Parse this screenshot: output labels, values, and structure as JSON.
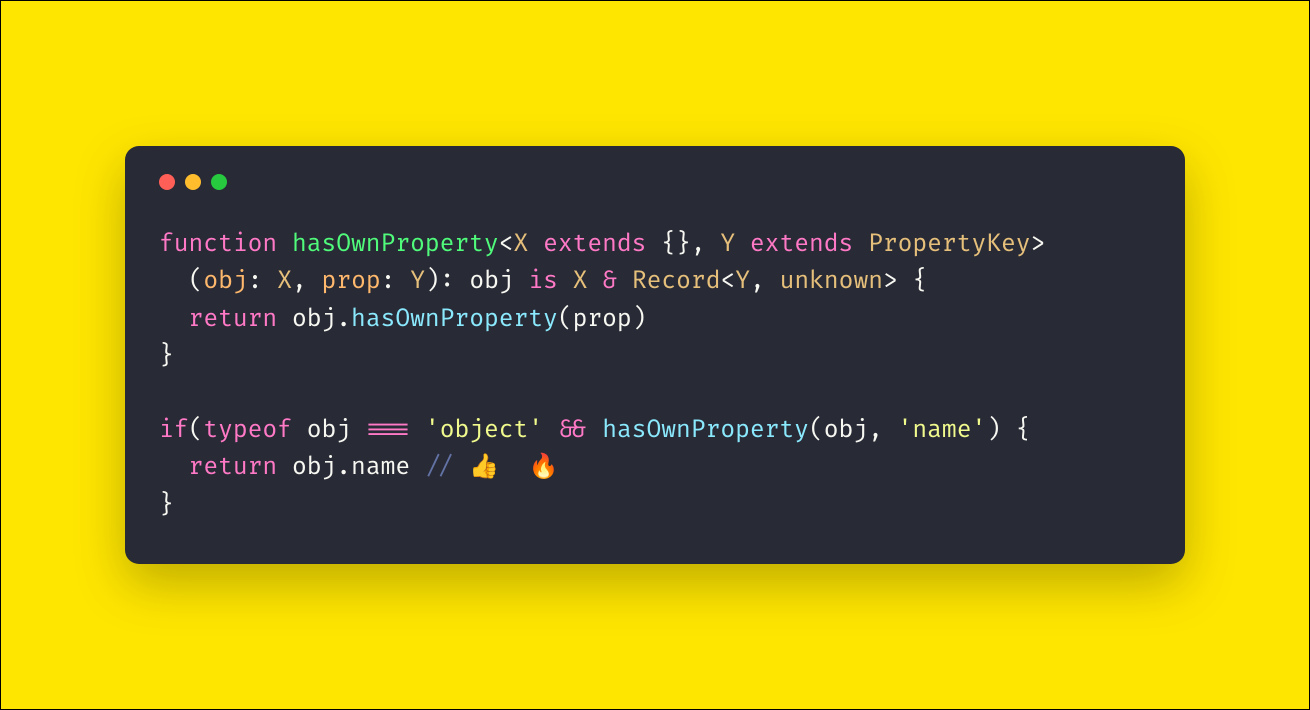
{
  "window": {
    "trafficLights": [
      "red",
      "yellow",
      "green"
    ]
  },
  "tokens": {
    "l1": {
      "kw_function": "function",
      "sp1": " ",
      "fn_name": "hasOwnProperty",
      "lt1": "<",
      "type_X": "X",
      "sp2": " ",
      "kw_extends1": "extends",
      "sp3": " ",
      "braces1": "{}",
      "comma1": ",",
      "sp4": " ",
      "type_Y": "Y",
      "sp5": " ",
      "kw_extends2": "extends",
      "sp6": " ",
      "type_PropertyKey": "PropertyKey",
      "gt1": ">"
    },
    "l2": {
      "indent": "  ",
      "lparen": "(",
      "param_obj": "obj",
      "colon1": ":",
      "sp1": " ",
      "type_X": "X",
      "comma1": ",",
      "sp2": " ",
      "param_prop": "prop",
      "colon2": ":",
      "sp3": " ",
      "type_Y": "Y",
      "rparen": ")",
      "colon3": ":",
      "sp4": " ",
      "plain_obj": "obj",
      "sp5": " ",
      "kw_is": "is",
      "sp6": " ",
      "type_X2": "X",
      "sp7": " ",
      "amp": "&",
      "sp8": " ",
      "type_Record": "Record",
      "lt": "<",
      "type_Y2": "Y",
      "comma2": ",",
      "sp9": " ",
      "type_unknown": "unknown",
      "gt": ">",
      "sp10": " ",
      "lbrace": "{"
    },
    "l3": {
      "indent": "  ",
      "kw_return": "return",
      "sp1": " ",
      "plain_obj": "obj",
      "dot": ".",
      "call_hop": "hasOwnProperty",
      "lparen": "(",
      "plain_prop": "prop",
      "rparen": ")"
    },
    "l4": {
      "rbrace": "}"
    },
    "l6": {
      "kw_if": "if",
      "lparen": "(",
      "kw_typeof": "typeof",
      "sp1": " ",
      "plain_obj": "obj",
      "sp2": " ",
      "op_eqeqeq": "===",
      "sp3": " ",
      "str_object": "'object'",
      "sp4": " ",
      "op_and": "&&",
      "sp5": " ",
      "call_hop": "hasOwnProperty",
      "lparen2": "(",
      "plain_obj2": "obj",
      "comma": ",",
      "sp6": " ",
      "str_name": "'name'",
      "rparen2": ")",
      "sp7": " ",
      "lbrace": "{"
    },
    "l7": {
      "indent": "  ",
      "kw_return": "return",
      "sp1": " ",
      "plain_obj": "obj",
      "dot": ".",
      "plain_name": "name",
      "sp2": " ",
      "comment": "// 👍  🔥"
    },
    "l8": {
      "rbrace": "}"
    }
  }
}
